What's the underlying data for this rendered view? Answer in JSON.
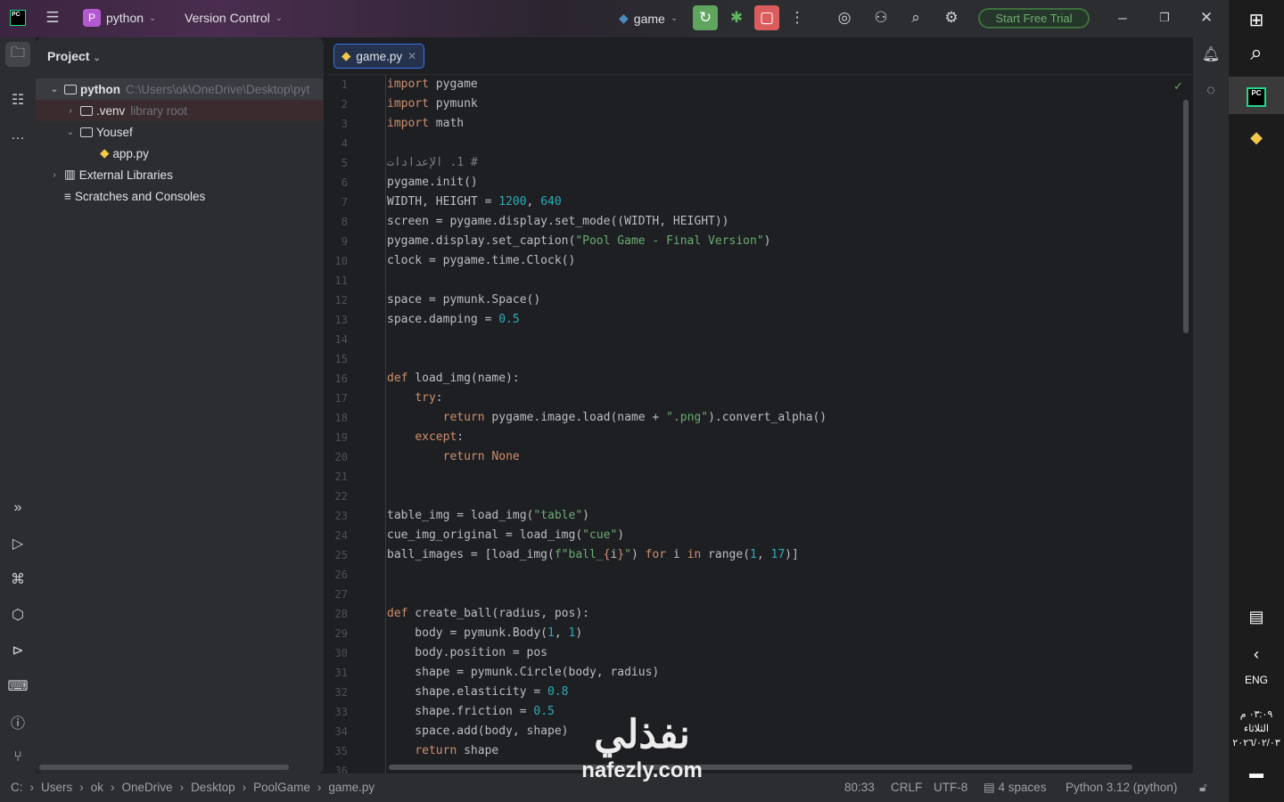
{
  "titlebar": {
    "project_badge": "P",
    "project_name": "python",
    "vcs": "Version Control",
    "run_config": "game",
    "trial": "Start Free Trial",
    "app_logo": "PC"
  },
  "project_panel": {
    "title": "Project",
    "tree": [
      {
        "label": "python",
        "hint": "C:\\Users\\ok\\OneDrive\\Desktop\\pyt",
        "type": "folder",
        "expanded": true
      },
      {
        "label": ".venv",
        "hint": "library root",
        "type": "folder",
        "expanded": false
      },
      {
        "label": "Yousef",
        "hint": "",
        "type": "folder",
        "expanded": true
      },
      {
        "label": "app.py",
        "hint": "",
        "type": "python-file"
      },
      {
        "label": "External Libraries",
        "hint": "",
        "type": "library",
        "expanded": false
      },
      {
        "label": "Scratches and Consoles",
        "hint": "",
        "type": "scratch"
      }
    ]
  },
  "editor": {
    "tab": "game.py",
    "lines": [
      [
        [
          "k",
          "import"
        ],
        [
          "p",
          " pygame"
        ]
      ],
      [
        [
          "k",
          "import"
        ],
        [
          "p",
          " pymunk"
        ]
      ],
      [
        [
          "k",
          "import"
        ],
        [
          "p",
          " math"
        ]
      ],
      [],
      [
        [
          "c",
          "# 1. الإعدادات"
        ]
      ],
      [
        [
          "p",
          "pygame.init()"
        ]
      ],
      [
        [
          "p",
          "WIDTH, HEIGHT = "
        ],
        [
          "n",
          "1200"
        ],
        [
          "p",
          ", "
        ],
        [
          "n",
          "640"
        ]
      ],
      [
        [
          "p",
          "screen = pygame.display.set_mode((WIDTH, HEIGHT))"
        ]
      ],
      [
        [
          "p",
          "pygame.display.set_caption("
        ],
        [
          "s",
          "\"Pool Game - Final Version\""
        ],
        [
          "p",
          ")"
        ]
      ],
      [
        [
          "p",
          "clock = pygame.time.Clock()"
        ]
      ],
      [],
      [
        [
          "p",
          "space = pymunk.Space()"
        ]
      ],
      [
        [
          "p",
          "space.damping = "
        ],
        [
          "n",
          "0.5"
        ]
      ],
      [],
      [],
      [
        [
          "k",
          "def"
        ],
        [
          "p",
          " load_img(name):"
        ]
      ],
      [
        [
          "p",
          "    "
        ],
        [
          "k",
          "try"
        ],
        [
          "p",
          ":"
        ]
      ],
      [
        [
          "p",
          "        "
        ],
        [
          "k",
          "return"
        ],
        [
          "p",
          " pygame.image.load(name + "
        ],
        [
          "s",
          "\".png\""
        ],
        [
          "p",
          ").convert_alpha()"
        ]
      ],
      [
        [
          "p",
          "    "
        ],
        [
          "k",
          "except"
        ],
        [
          "p",
          ":"
        ]
      ],
      [
        [
          "p",
          "        "
        ],
        [
          "k",
          "return None"
        ]
      ],
      [],
      [],
      [
        [
          "p",
          "table_img = load_img("
        ],
        [
          "s",
          "\"table\""
        ],
        [
          "p",
          ")"
        ]
      ],
      [
        [
          "p",
          "cue_img_original = load_img("
        ],
        [
          "s",
          "\"cue\""
        ],
        [
          "p",
          ")"
        ]
      ],
      [
        [
          "p",
          "ball_images = [load_img("
        ],
        [
          "s",
          "f\"ball_"
        ],
        [
          "k",
          "{"
        ],
        [
          "p",
          "i"
        ],
        [
          "k",
          "}"
        ],
        [
          "s",
          "\""
        ],
        [
          "p",
          ") "
        ],
        [
          "k",
          "for"
        ],
        [
          "p",
          " i "
        ],
        [
          "k",
          "in"
        ],
        [
          "p",
          " range("
        ],
        [
          "n",
          "1"
        ],
        [
          "p",
          ", "
        ],
        [
          "n",
          "17"
        ],
        [
          "p",
          ")]"
        ]
      ],
      [],
      [],
      [
        [
          "k",
          "def"
        ],
        [
          "p",
          " create_ball(radius, pos):"
        ]
      ],
      [
        [
          "p",
          "    body = pymunk.Body("
        ],
        [
          "n",
          "1"
        ],
        [
          "p",
          ", "
        ],
        [
          "n",
          "1"
        ],
        [
          "p",
          ")"
        ]
      ],
      [
        [
          "p",
          "    body.position = pos"
        ]
      ],
      [
        [
          "p",
          "    shape = pymunk.Circle(body, radius)"
        ]
      ],
      [
        [
          "p",
          "    shape.elasticity = "
        ],
        [
          "n",
          "0.8"
        ]
      ],
      [
        [
          "p",
          "    shape.friction = "
        ],
        [
          "n",
          "0.5"
        ]
      ],
      [
        [
          "p",
          "    space.add(body, shape)"
        ]
      ],
      [
        [
          "p",
          "    "
        ],
        [
          "k",
          "return"
        ],
        [
          "p",
          " shape"
        ]
      ],
      []
    ]
  },
  "statusbar": {
    "breadcrumb": [
      "C:",
      "Users",
      "ok",
      "OneDrive",
      "Desktop",
      "PoolGame",
      "game.py"
    ],
    "position": "80:33",
    "line_sep": "CRLF",
    "encoding": "UTF-8",
    "indent": "4 spaces",
    "interpreter": "Python 3.12 (python)"
  },
  "taskbar": {
    "lang": "ENG",
    "time": "٠٣:٠٩ م",
    "day": "الثلاثاء",
    "date": "٢٠٢٦/٠٢/٠٣"
  },
  "watermark": {
    "arabic": "نفذلي",
    "latin": "nafezly.com"
  },
  "colors": {
    "keyword": "#cf8e6d",
    "string": "#6aab73",
    "number": "#2aacb8",
    "comment": "#7a7e85",
    "run": "#5fa55f",
    "stop": "#db5c5c"
  }
}
